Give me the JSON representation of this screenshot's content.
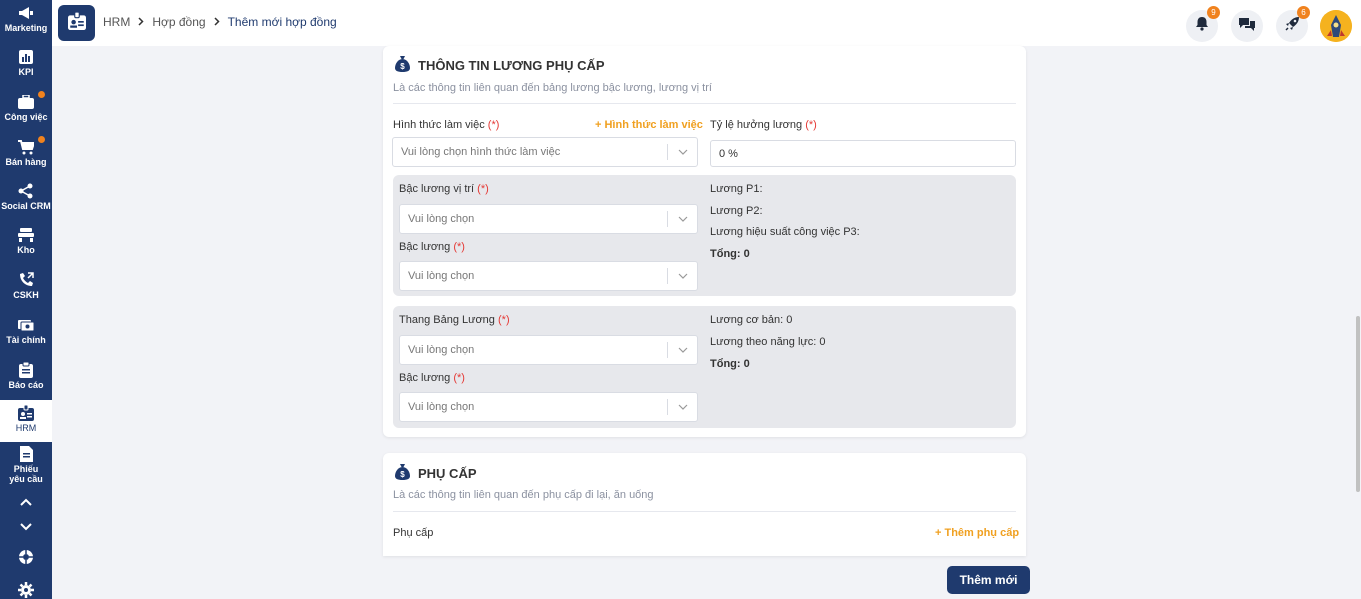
{
  "sidebar": {
    "items": [
      {
        "label": "Marketing",
        "icon": "megaphone-icon"
      },
      {
        "label": "KPI",
        "icon": "chart-icon"
      },
      {
        "label": "Công việc",
        "icon": "briefcase-icon"
      },
      {
        "label": "Bán hàng",
        "icon": "cart-icon"
      },
      {
        "label": "Social CRM",
        "icon": "share-icon"
      },
      {
        "label": "Kho",
        "icon": "warehouse-icon"
      },
      {
        "label": "CSKH",
        "icon": "phone-icon"
      },
      {
        "label": "Tài chính",
        "icon": "money-icon"
      },
      {
        "label": "Báo cáo",
        "icon": "clipboard-icon"
      },
      {
        "label": "HRM",
        "icon": "id-card-icon"
      },
      {
        "label": "Phiếu yêu cầu",
        "icon": "document-icon"
      }
    ],
    "notify_color": "#f0821e"
  },
  "header": {
    "breadcrumb": [
      "HRM",
      "Hợp đồng",
      "Thêm mới hợp đồng"
    ],
    "notifications_count": "9",
    "rocket_count": "6"
  },
  "salary": {
    "title": "THÔNG TIN LƯƠNG PHỤ CẤP",
    "subtitle": "Là các thông tin liên quan đến bảng lương bậc lương, lương vị trí",
    "work_form_label": "Hình thức làm việc",
    "required_mark": "(*)",
    "add_work_form_link": "+ Hình thức làm việc",
    "work_form_placeholder": "Vui lòng chọn hình thức làm việc",
    "salary_rate_label": "Tỷ lệ hưởng lương",
    "salary_rate_value": "0 %",
    "position_grade_label": "Bậc lương vị trí",
    "position_grade_placeholder": "Vui lòng chọn",
    "grade_label": "Bậc lương",
    "grade_placeholder": "Vui lòng chọn",
    "p1": "Lương P1:",
    "p2": "Lương P2:",
    "p3": "Lương hiệu suất công việc P3:",
    "total1": "Tổng: 0",
    "scale_label": "Thang Bảng Lương",
    "scale_placeholder": "Vui lòng chọn",
    "grade2_label": "Bậc lương",
    "grade2_placeholder": "Vui lòng chọn",
    "base_salary": "Lương cơ bản: 0",
    "ability_salary": "Lương theo năng lực: 0",
    "total2": "Tổng: 0"
  },
  "allowance": {
    "title": "PHỤ CẤP",
    "subtitle": "Là các thông tin liên quan đến phụ cấp đi lại, ăn uống",
    "label": "Phụ cấp",
    "add_link": "+ Thêm phụ cấp"
  },
  "submit_label": "Thêm mới",
  "colors": {
    "primary": "#1f3a6e",
    "accent": "#f0a020",
    "required": "#e53935"
  }
}
